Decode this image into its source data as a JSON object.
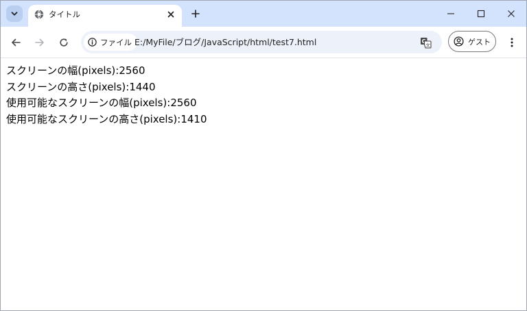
{
  "tab": {
    "title": "タイトル"
  },
  "toolbar": {
    "site_chip_label": "ファイル",
    "url": "E:/MyFile/ブログ/JavaScript/html/test7.html"
  },
  "profile": {
    "label": "ゲスト"
  },
  "page": {
    "lines": [
      "スクリーンの幅(pixels):2560",
      "スクリーンの高さ(pixels):1440",
      "使用可能なスクリーンの幅(pixels):2560",
      "使用可能なスクリーンの高さ(pixels):1410"
    ]
  },
  "colors": {
    "tabstrip_bg": "#d3e3fd",
    "omnibox_bg": "#edf2fa",
    "text": "#000000"
  },
  "icons": {
    "tab_search": "chevron-down-icon",
    "favicon": "globe-icon",
    "tab_close": "close-icon",
    "new_tab": "plus-icon",
    "minimize": "minimize-icon",
    "maximize": "maximize-icon",
    "close_window": "close-icon",
    "back": "arrow-left-icon",
    "forward": "arrow-right-icon",
    "reload": "reload-icon",
    "site_info": "info-icon",
    "translate": "translate-icon",
    "profile": "account-icon",
    "menu": "kebab-menu-icon"
  }
}
